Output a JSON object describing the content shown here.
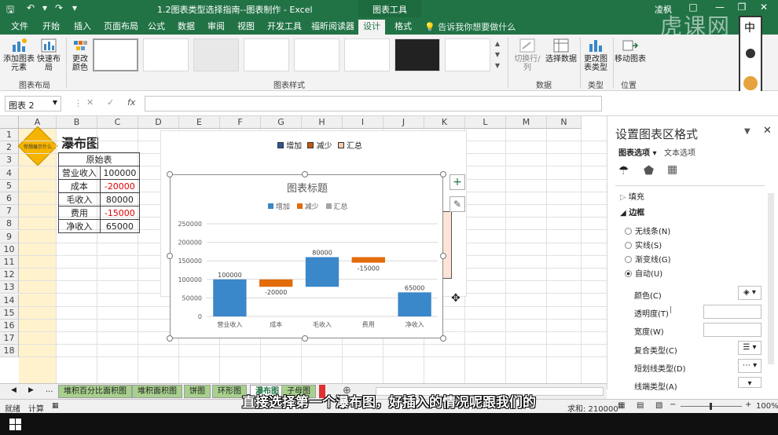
{
  "titlebar": {
    "doc_title": "1.2图表类型选择指南--图表制作 - Excel",
    "context_title": "图表工具",
    "user": "凌枫"
  },
  "tabs": [
    "文件",
    "开始",
    "插入",
    "页面布局",
    "公式",
    "数据",
    "审阅",
    "视图",
    "开发工具",
    "福昕阅读器",
    "设计",
    "格式"
  ],
  "active_tab": "设计",
  "tellme": "告诉我你想要做什么",
  "ribbon": {
    "add_element": "添加图表元素",
    "quick_layout": "快速布局",
    "change_colors": "更改颜色",
    "group_layout": "图表布局",
    "group_styles": "图表样式",
    "switch_rowcol": "切换行/列",
    "select_data": "选择数据",
    "group_data": "数据",
    "change_type": "更改图表类型",
    "group_type": "类型",
    "move_chart": "移动图表",
    "group_location": "位置"
  },
  "formula_bar": {
    "namebox": "图表 2",
    "fx": "fx",
    "value": ""
  },
  "columns": [
    "A",
    "B",
    "C",
    "D",
    "E",
    "F",
    "G",
    "H",
    "I",
    "J",
    "K",
    "L",
    "M",
    "N"
  ],
  "rows": [
    "1",
    "2",
    "3",
    "4",
    "5",
    "6",
    "7",
    "8",
    "9",
    "10",
    "11",
    "12",
    "13",
    "14",
    "15",
    "16",
    "17",
    "18"
  ],
  "sheet": {
    "title": "瀑布图",
    "logo_text": "你想展示什么",
    "table_header": "原始表",
    "table_rows": [
      {
        "label": "营业收入",
        "value": "100000",
        "neg": false
      },
      {
        "label": "成本",
        "value": "-20000",
        "neg": true
      },
      {
        "label": "毛收入",
        "value": "80000",
        "neg": false
      },
      {
        "label": "费用",
        "value": "-15000",
        "neg": true
      },
      {
        "label": "净收入",
        "value": "65000",
        "neg": false
      }
    ]
  },
  "bg_chart": {
    "legend": [
      "增加",
      "减少",
      "汇总"
    ],
    "ytop": "120000",
    "partial": "100000"
  },
  "chart_data": {
    "type": "waterfall",
    "title": "图表标题",
    "legend": [
      "增加",
      "减少",
      "汇总"
    ],
    "categories": [
      "营业收入",
      "成本",
      "毛收入",
      "费用",
      "净收入"
    ],
    "values": [
      100000,
      -20000,
      80000,
      -15000,
      65000
    ],
    "data_labels": [
      "100000",
      "-20000",
      "80000",
      "-15000",
      "65000"
    ],
    "ylim": [
      0,
      250000
    ],
    "yticks": [
      "0",
      "50000",
      "100000",
      "150000",
      "200000",
      "250000"
    ],
    "colors": {
      "increase": "#3a87c9",
      "decrease": "#e26b0a",
      "total": "#a5a5a5"
    },
    "legend_position": "top"
  },
  "pane": {
    "title": "设置图表区格式",
    "tab_options": "图表选项",
    "tab_text": "文本选项",
    "fill": "填充",
    "border": "边框",
    "radio": [
      "无线条(N)",
      "实线(S)",
      "渐变线(G)",
      "自动(U)"
    ],
    "color": "颜色(C)",
    "transparency": "透明度(T)",
    "width": "宽度(W)",
    "compound": "复合类型(C)",
    "dash": "短划线类型(D)",
    "cap": "线端类型(A)"
  },
  "sheet_tabs": [
    "堆积百分比面积图",
    "堆积面积图",
    "饼图",
    "环形图",
    "瀑布图",
    "子母图"
  ],
  "active_sheet": "瀑布图",
  "status": {
    "ready": "就绪",
    "calc": "计算",
    "sum": "求和: 210000",
    "zoom": "100%"
  },
  "subtitle": "直接选择第一个瀑布图，好插入的情况呢跟我们的",
  "watermark": "虎课网",
  "colors": {
    "excel_green": "#217346",
    "col_a_fill": "#fff2cc"
  }
}
